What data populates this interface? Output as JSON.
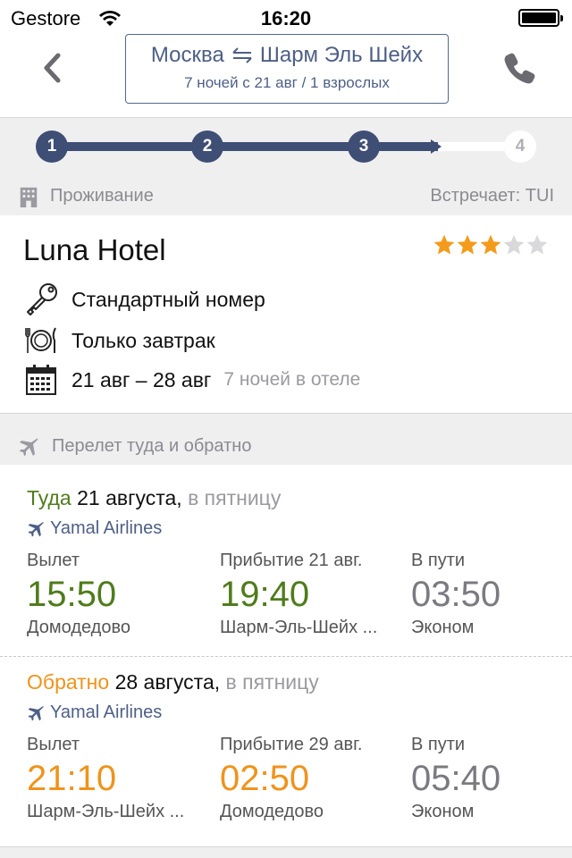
{
  "status_bar": {
    "carrier": "Gestore",
    "time": "16:20"
  },
  "nav": {
    "route_from": "Москва",
    "route_to": "Шарм Эль Шейх",
    "route_details": "7 ночей с 21 авг / 1 взрослых"
  },
  "stepper": {
    "steps": [
      "1",
      "2",
      "3",
      "4"
    ],
    "current_step": 3
  },
  "accommodation": {
    "section_title": "Проживание",
    "operator": "Встречает: TUI",
    "hotel_name": "Luna Hotel",
    "stars_filled": 3,
    "stars_total": 5,
    "room": "Стандартный номер",
    "meal": "Только завтрак",
    "dates": "21 авг – 28 авг",
    "nights": "7 ночей в отеле"
  },
  "flight": {
    "section_title": "Перелет туда и обратно",
    "outbound": {
      "direction": "Туда",
      "date": "21 августа,",
      "weekday": "в пятницу",
      "airline": "Yamal Airlines",
      "depart_label": "Вылет",
      "depart_time": "15:50",
      "depart_airport": "Домодедово",
      "arrive_label": "Прибытие 21 авг.",
      "arrive_time": "19:40",
      "arrive_airport": "Шарм-Эль-Шейх ...",
      "duration_label": "В пути",
      "duration": "03:50",
      "class": "Эконом"
    },
    "return": {
      "direction": "Обратно",
      "date": "28 августа,",
      "weekday": "в пятницу",
      "airline": "Yamal Airlines",
      "depart_label": "Вылет",
      "depart_time": "21:10",
      "depart_airport": "Шарм-Эль-Шейх ...",
      "arrive_label": "Прибытие 29 авг.",
      "arrive_time": "02:50",
      "arrive_airport": "Домодедово",
      "duration_label": "В пути",
      "duration": "05:40",
      "class": "Эконом"
    }
  },
  "colors": {
    "brand_navy": "#3e4e74",
    "outbound_green": "#4f7c1b",
    "return_orange": "#f0931b",
    "star": "#f49b1b"
  }
}
